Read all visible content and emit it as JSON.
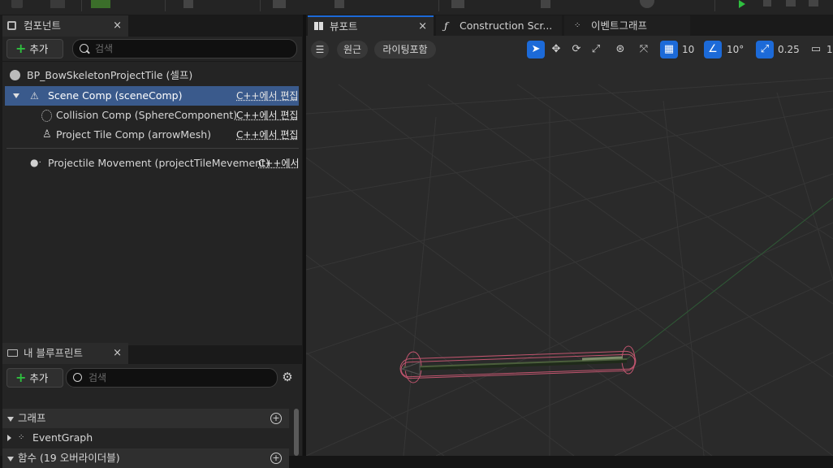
{
  "topbar": {
    "items": [
      "",
      "",
      "",
      "",
      ""
    ]
  },
  "left": {
    "components_tab": {
      "label": "컴포넌트",
      "close": "×"
    },
    "add_label": "추가",
    "search_placeholder": "검색",
    "tree": {
      "root": "BP_BowSkeletonProjectTile (셀프)",
      "items": [
        {
          "label": "Scene Comp (sceneComp)",
          "link": "C++에서 편집"
        },
        {
          "label": "Collision Comp (SphereComponent)",
          "link": "C++에서 편집"
        },
        {
          "label": "Project Tile Comp (arrowMesh)",
          "link": "C++에서 편집"
        },
        {
          "label": "Projectile Movement (projectTileMevement)",
          "link": "C++에서"
        }
      ]
    },
    "my_bp_tab": {
      "label": "내 블루프린트",
      "close": "×"
    },
    "my_bp_add": "추가",
    "my_bp_search": "검색",
    "sections": {
      "graph": "그래프",
      "eventgraph": "EventGraph",
      "functions": "함수 (19 오버라이더블)"
    }
  },
  "tabs": {
    "viewport": "뷰포트",
    "construction": "Construction Scr...",
    "event": "이벤트그래프",
    "close": "×"
  },
  "viewport": {
    "perspective": "원근",
    "lighting": "라이팅포함",
    "grid_snap": "10",
    "rot_snap": "10°",
    "scale_snap": "0.25",
    "cam": "1"
  },
  "colors": {
    "accent": "#1c6ad8",
    "add_plus": "#2fbf3f",
    "collision": "#c0556e"
  }
}
